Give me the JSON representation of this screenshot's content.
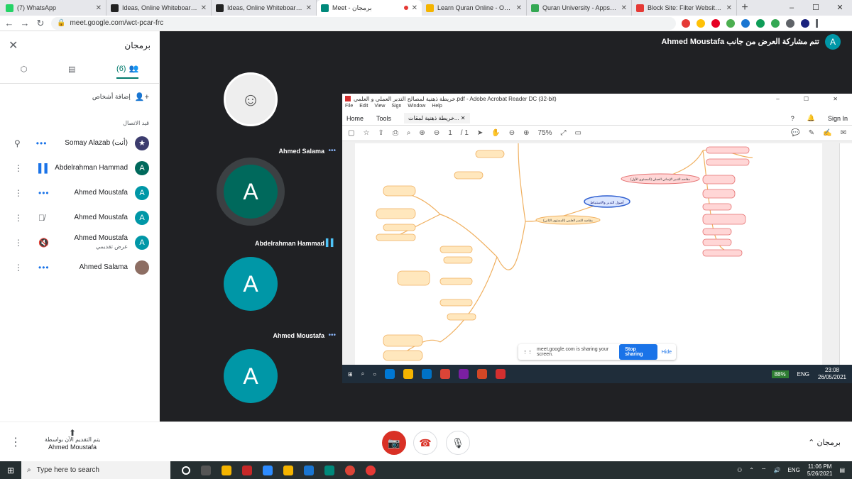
{
  "browser": {
    "tabs": [
      {
        "title": "(7) WhatsApp",
        "color": "#25d366",
        "active": false
      },
      {
        "title": "Ideas, Online Whiteboard for Vis",
        "color": "#222222",
        "active": false
      },
      {
        "title": "Ideas, Online Whiteboard for Vis",
        "color": "#222222",
        "active": false
      },
      {
        "title": "Meet - برمجان",
        "color": "#00897b",
        "active": true
      },
      {
        "title": "Learn Quran Online - Online Qu",
        "color": "#f4b400",
        "active": false
      },
      {
        "title": "Quran University - Apps on Goo",
        "color": "#34a853",
        "active": false
      },
      {
        "title": "Block Site: Filter Websites and C",
        "color": "#e53935",
        "active": false
      }
    ],
    "url": "meet.google.com/wct-pcar-frc"
  },
  "sidebar": {
    "title": "برمجان",
    "tab_people_count": "(6)",
    "add_people": "إضافة أشخاص",
    "section_label": "قيد الاتصال",
    "people": [
      {
        "name": "Somay Alazab (أنت)",
        "sub": "",
        "avatar": "★",
        "color": "#3c3c6e"
      },
      {
        "name": "Abdelrahman Hammad",
        "sub": "",
        "avatar": "A",
        "color": "#00695c"
      },
      {
        "name": "Ahmed Moustafa",
        "sub": "",
        "avatar": "A",
        "color": "#0097a7"
      },
      {
        "name": "Ahmed Moustafa",
        "sub": "",
        "avatar": "A",
        "color": "#0097a7"
      },
      {
        "name": "Ahmed Moustafa",
        "sub": "عرض تقديمي",
        "avatar": "A",
        "color": "#0097a7"
      },
      {
        "name": "Ahmed Salama",
        "sub": "",
        "avatar": "",
        "color": "#8d6e63"
      }
    ]
  },
  "stage": {
    "presenter_title": "Ahmed Moustafa تتم مشاركة العرض من جانب",
    "presenter_avatar": "A",
    "tiles": [
      {
        "name": "Ahmed Salama",
        "avatar": "",
        "color": "#ffffff"
      },
      {
        "name": "Abdelrahman Hammad",
        "avatar": "A",
        "color": "#00695c"
      },
      {
        "name": "Ahmed Moustafa",
        "avatar": "A",
        "color": "#0097a7"
      },
      {
        "name": "Ahmed Moustafa",
        "avatar": "A",
        "color": "#0097a7"
      }
    ]
  },
  "shared": {
    "acrobat_title": "خريطة ذهنية لمصالح التدبر العملي و العلمي.pdf - Adobe Acrobat Reader DC (32-bit)",
    "menu": [
      "File",
      "Edit",
      "View",
      "Sign",
      "Window",
      "Help"
    ],
    "tab_home": "Home",
    "tab_tools": "Tools",
    "doc_tab": "خريطة ذهنية لمقات...",
    "page": "1",
    "page_total": "/ 1",
    "zoom": "75%",
    "sign_in": "Sign In",
    "center_node": "أصول التدبر والاستنباط",
    "node_left": "مقاصد التدبر العلمي (المستوى الثاني)",
    "node_right": "مقاصد التدبر الإيماني العملي (المستوى الأول)",
    "share_msg": "meet.google.com is sharing your screen.",
    "stop_sharing": "Stop sharing",
    "hide": "Hide",
    "win_time": "23:08",
    "win_date": "26/05/2021",
    "win_lang": "ENG",
    "battery": "88%"
  },
  "controls": {
    "presenting_line": "يتم التقديم الآن بواسطة",
    "presenting_name": "Ahmed Moustafa",
    "meeting_name": "برمجان"
  },
  "os": {
    "search_placeholder": "Type here to search",
    "time": "11:06 PM",
    "date": "5/26/2021",
    "lang": "ENG"
  }
}
